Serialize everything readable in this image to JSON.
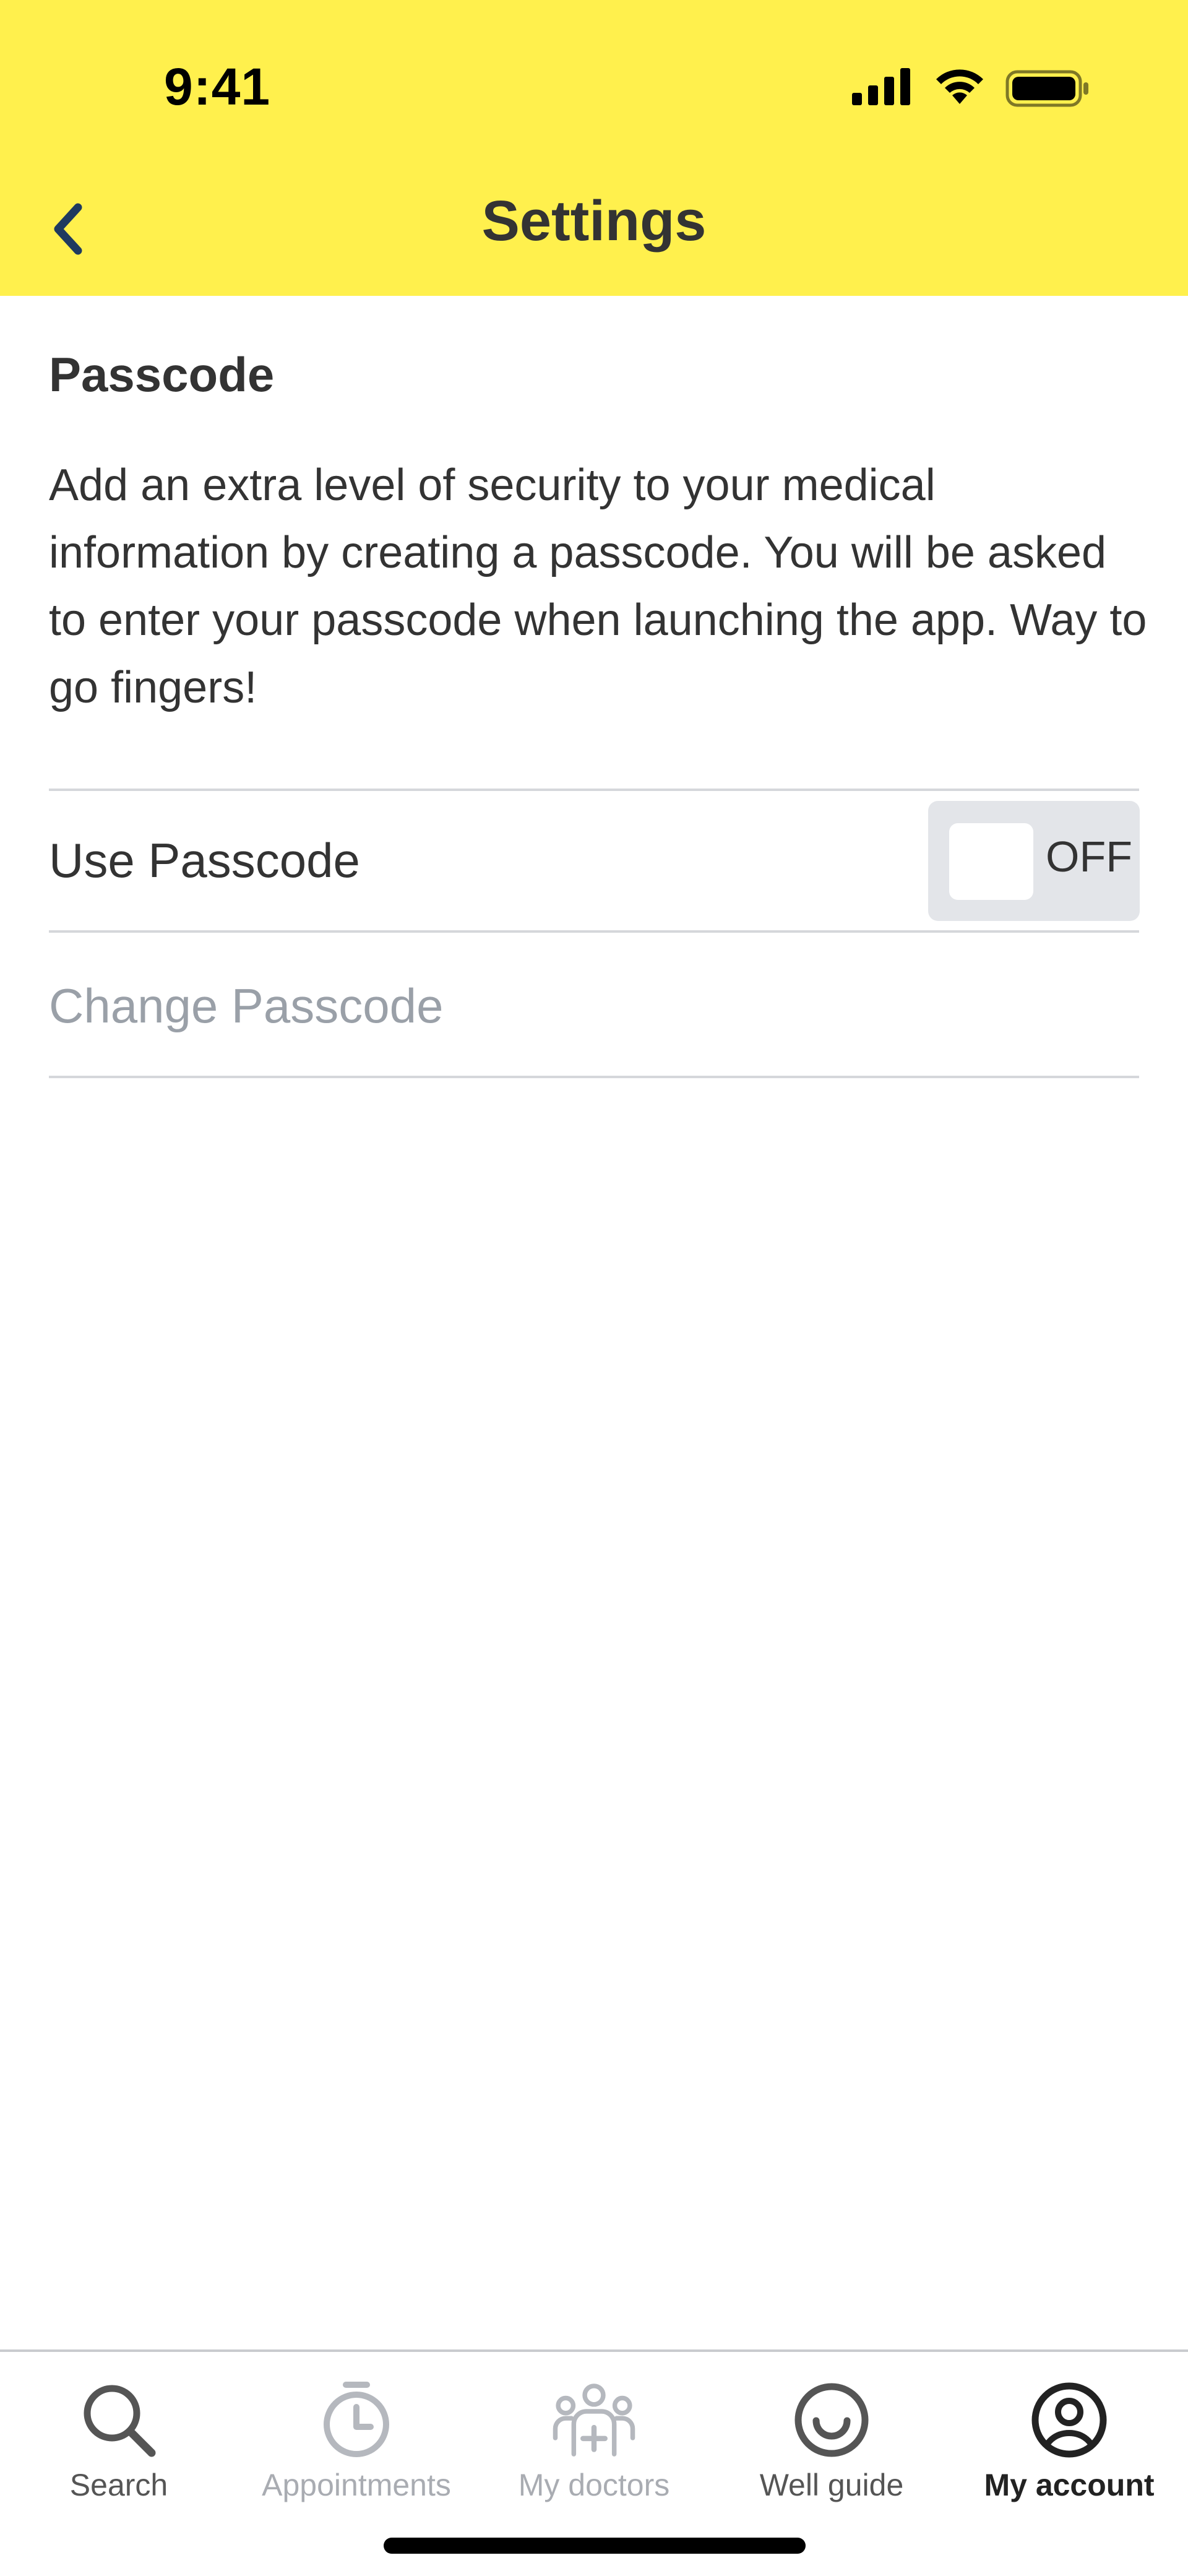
{
  "status_bar": {
    "time": "9:41",
    "icons": [
      "signal-icon",
      "wifi-icon",
      "battery-icon"
    ]
  },
  "header": {
    "title": "Settings",
    "back_icon": "chevron-left-icon",
    "background_color": "#FFF04D",
    "back_color": "#1F3A5F"
  },
  "passcode": {
    "section_title": "Passcode",
    "description": "Add an extra level of security to your medical information by creating a passcode. You will be asked to enter your passcode when launching the app. Way to go fingers!",
    "use_passcode_label": "Use Passcode",
    "toggle_state": "OFF",
    "change_passcode_label": "Change Passcode"
  },
  "tabbar": {
    "tabs": [
      {
        "label": "Search",
        "icon": "search-icon",
        "state": "normal"
      },
      {
        "label": "Appointments",
        "icon": "clock-icon",
        "state": "inactive"
      },
      {
        "label": "My doctors",
        "icon": "doctors-icon",
        "state": "inactive"
      },
      {
        "label": "Well guide",
        "icon": "smile-icon",
        "state": "normal"
      },
      {
        "label": "My account",
        "icon": "account-icon",
        "state": "active"
      }
    ]
  }
}
